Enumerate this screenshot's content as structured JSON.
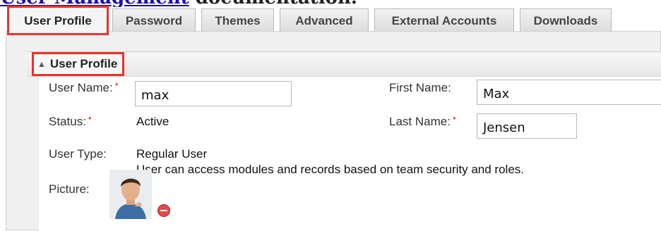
{
  "doc_header": {
    "link_text": "User Management",
    "rest_text": " documentation."
  },
  "tabs": [
    {
      "label": "User Profile",
      "active": true
    },
    {
      "label": "Password"
    },
    {
      "label": "Themes"
    },
    {
      "label": "Advanced"
    },
    {
      "label": "External Accounts"
    },
    {
      "label": "Downloads"
    }
  ],
  "section": {
    "title": "User Profile"
  },
  "fields": {
    "user_name": {
      "label": "User Name:",
      "value": "max"
    },
    "status": {
      "label": "Status:",
      "value": "Active"
    },
    "user_type": {
      "label": "User Type:",
      "value": "Regular User",
      "description": "User can access modules and records based on team security and roles."
    },
    "picture": {
      "label": "Picture:"
    },
    "first_name": {
      "label": "First Name:",
      "value": "Max"
    },
    "last_name": {
      "label": "Last Name:",
      "value": "Jensen"
    }
  },
  "required_mark": "*",
  "colors": {
    "highlight": "#e8332a",
    "required": "#d40000",
    "link": "#1a0dab"
  }
}
